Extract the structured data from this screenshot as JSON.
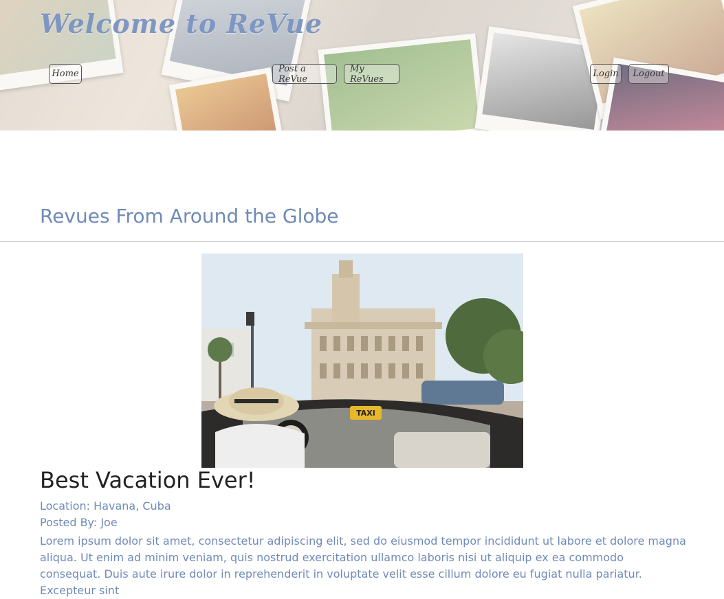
{
  "header": {
    "title": "Welcome to ReVue",
    "nav": {
      "home": "Home",
      "post": "Post a ReVue",
      "my_revues": "My ReVues",
      "login": "Login",
      "logout": "Logout"
    }
  },
  "main": {
    "section_title": "Revues From Around the Globe",
    "post": {
      "title": "Best Vacation Ever!",
      "location_label": "Location:",
      "location": "Havana, Cuba",
      "posted_label": "Posted By:",
      "author": "Joe",
      "taxi_sign": "TAXI",
      "body": "Lorem ipsum dolor sit amet, consectetur adipiscing elit, sed do eiusmod tempor incididunt ut labore et dolore magna aliqua. Ut enim ad minim veniam, quis nostrud exercitation ullamco laboris nisi ut aliquip ex ea commodo consequat. Duis aute irure dolor in reprehenderit in voluptate velit esse cillum dolore eu fugiat nulla pariatur. Excepteur sint"
    }
  },
  "colors": {
    "accent": "#6f8ab8",
    "title": "#7e96c2",
    "heading": "#222222"
  }
}
